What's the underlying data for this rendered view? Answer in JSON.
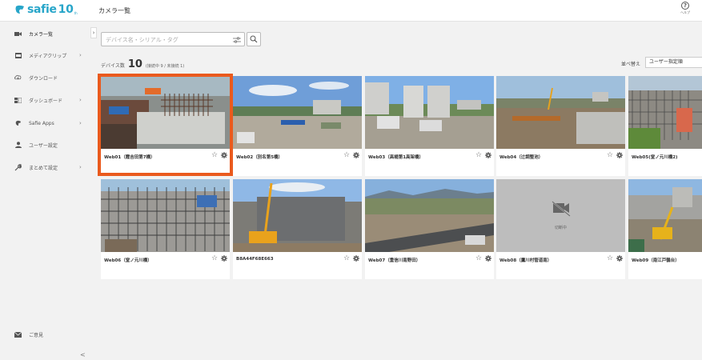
{
  "header": {
    "brand_name": "safie",
    "brand_number": "10",
    "brand_sub": "th",
    "page_title": "カメラ一覧",
    "help_label": "ヘルプ"
  },
  "sidebar": {
    "items": [
      {
        "label": "カメラ一覧",
        "icon": "camera-icon"
      },
      {
        "label": "メディアクリップ",
        "icon": "film-icon"
      },
      {
        "label": "ダウンロード",
        "icon": "cloud-download-icon"
      },
      {
        "label": "ダッシュボード",
        "icon": "dashboard-icon"
      },
      {
        "label": "Safie Apps",
        "icon": "apps-icon"
      },
      {
        "label": "ユーザー設定",
        "icon": "user-icon"
      },
      {
        "label": "まとめて設定",
        "icon": "wrench-icon"
      }
    ],
    "feedback_label": "ご意見",
    "collapse_glyph": "<"
  },
  "search": {
    "placeholder": "デバイス名・シリアル・タグ"
  },
  "summary": {
    "label": "デバイス数",
    "count": "10",
    "detail": "(接続中 9 / 未接続 1)"
  },
  "sort": {
    "label": "並べ替え",
    "selected": "ユーザー指定順"
  },
  "cameras": [
    {
      "name": "Web01（霞吉田第7橋）",
      "status": "online",
      "highlighted": true
    },
    {
      "name": "Web02（別名第5橋）",
      "status": "online"
    },
    {
      "name": "Web03（高楊第1高架橋）",
      "status": "online"
    },
    {
      "name": "Web04（辻調整池）",
      "status": "online"
    },
    {
      "name": "Web05(堂ノ元川橋2)",
      "status": "online"
    },
    {
      "name": "Web06（堂ノ元川橋）",
      "status": "online"
    },
    {
      "name": "B8A44F68E663",
      "status": "online"
    },
    {
      "name": "Web07（重信川南野田）",
      "status": "online"
    },
    {
      "name": "Web08（鷹川村管道南）",
      "status": "offline",
      "offline_label": "切断中"
    },
    {
      "name": "Web09（南江戸鶴台）",
      "status": "online"
    }
  ],
  "colors": {
    "brand": "#27a5c9",
    "highlight": "#ea5a1d",
    "offline_bg": "#bdbdbd"
  }
}
